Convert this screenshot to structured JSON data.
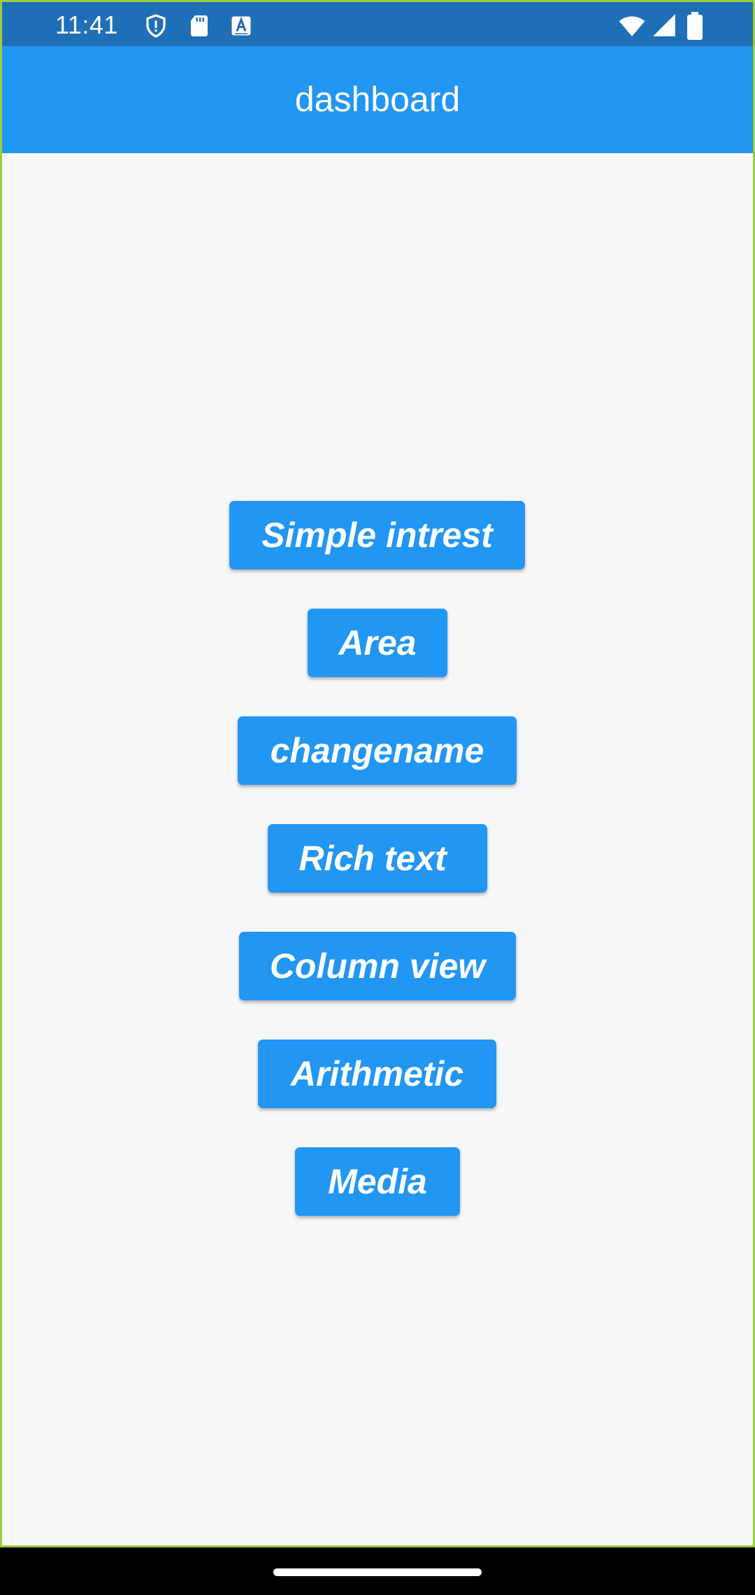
{
  "status_bar": {
    "time": "11:41",
    "icons": [
      "shield-alert-icon",
      "sd-card-icon",
      "text-a-icon",
      "wifi-icon",
      "cellular-signal-icon",
      "battery-icon"
    ]
  },
  "app_bar": {
    "title": "dashboard"
  },
  "buttons": [
    {
      "label": "Simple intrest"
    },
    {
      "label": "Area"
    },
    {
      "label": "changename"
    },
    {
      "label": "Rich text "
    },
    {
      "label": "Column view"
    },
    {
      "label": "Arithmetic"
    },
    {
      "label": "Media"
    }
  ],
  "colors": {
    "primary": "#2196f3",
    "status_bar": "#1e6fb6",
    "background": "#f7f7f9",
    "border": "#9ccc3c"
  }
}
